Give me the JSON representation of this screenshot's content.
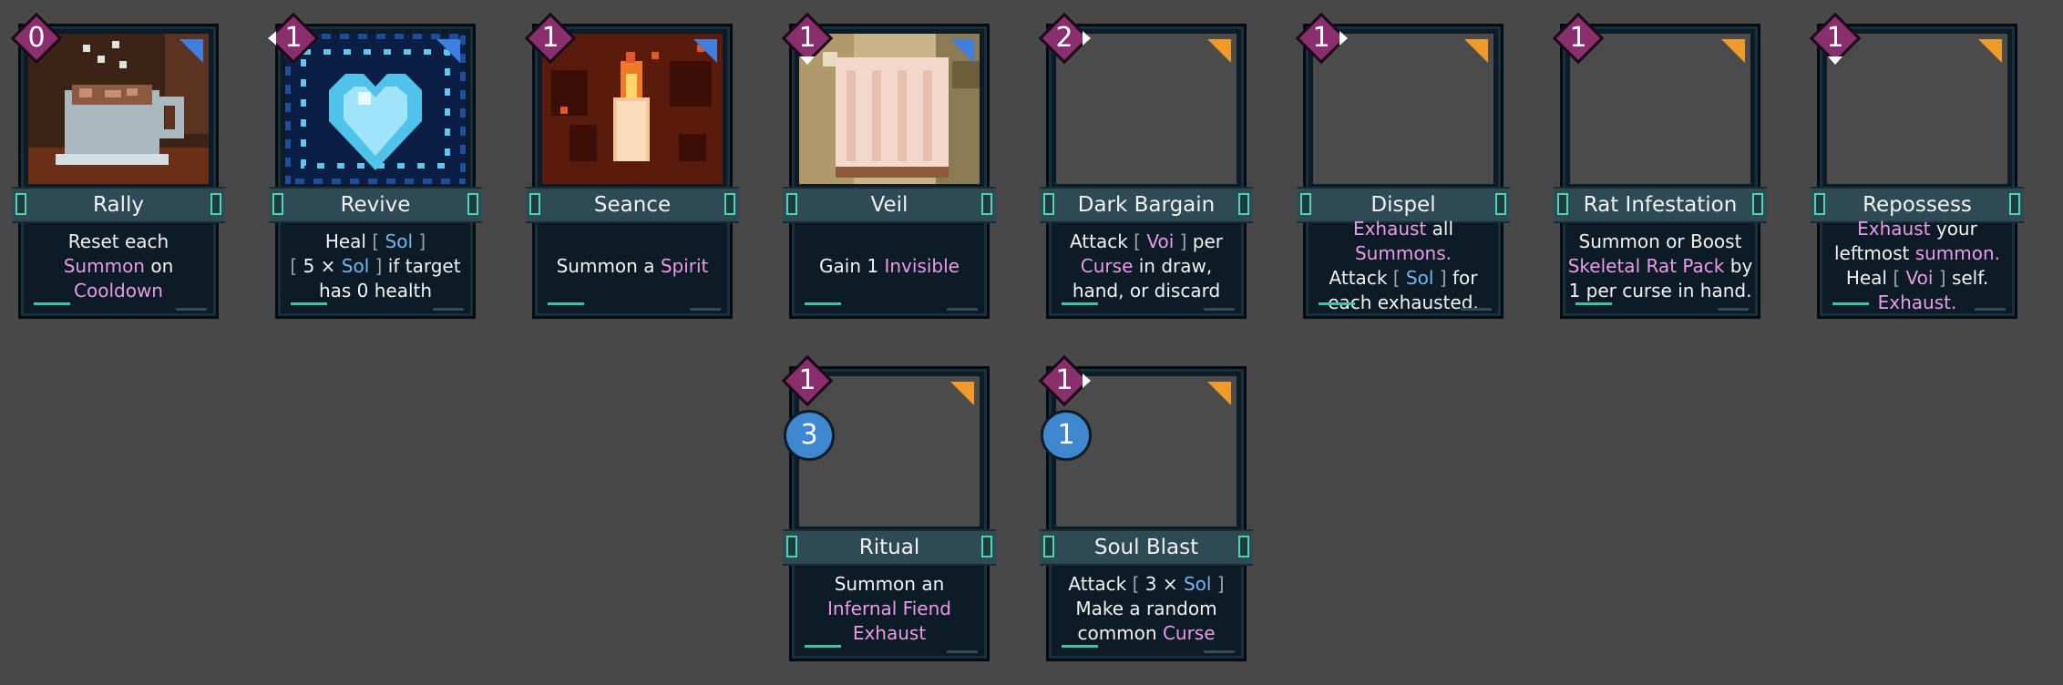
{
  "colors": {
    "background": "#484848",
    "cost_diamond": "#8a2f6d",
    "name_bar": "#2e4a55",
    "keyword_pink": "#e89be8",
    "keyword_blue": "#6fb8f0",
    "charge_circle": "#3f88d0"
  },
  "cards": [
    {
      "name": "Rally",
      "cost": "0",
      "rarity": "rare",
      "art": "coffee-cup",
      "description": [
        [
          {
            "t": "Reset each"
          }
        ],
        [
          {
            "t": "Summon",
            "k": "pink"
          },
          {
            "t": " on"
          }
        ],
        [
          {
            "t": "Cooldown",
            "k": "pink"
          }
        ]
      ]
    },
    {
      "name": "Revive",
      "cost": "1",
      "rarity": "rare",
      "art": "crystal-heart",
      "description": [
        [
          {
            "t": "Heal "
          },
          {
            "t": "[",
            "k": "br"
          },
          {
            "t": " Sol ",
            "k": "blue"
          },
          {
            "t": "]",
            "k": "br"
          }
        ],
        [
          {
            "t": "[",
            "k": "br"
          },
          {
            "t": " 5 × "
          },
          {
            "t": "Sol",
            "k": "blue"
          },
          {
            "t": " ]",
            "k": "br"
          },
          {
            "t": " if target"
          }
        ],
        [
          {
            "t": "has 0 health"
          }
        ]
      ]
    },
    {
      "name": "Seance",
      "cost": "1",
      "rarity": "rare",
      "art": "candle",
      "description": [
        [
          {
            "t": "Summon a "
          },
          {
            "t": "Spirit",
            "k": "pink"
          }
        ]
      ]
    },
    {
      "name": "Veil",
      "cost": "1",
      "rarity": "rare",
      "art": "veil-cloth",
      "description": [
        [
          {
            "t": "Gain 1 "
          },
          {
            "t": "Invisible",
            "k": "pink"
          }
        ]
      ]
    },
    {
      "name": "Dark Bargain",
      "cost": "2",
      "rarity": "common",
      "art": "blank",
      "description": [
        [
          {
            "t": "Attack "
          },
          {
            "t": "[",
            "k": "br"
          },
          {
            "t": " Voi ",
            "k": "pink"
          },
          {
            "t": "]",
            "k": "br"
          },
          {
            "t": " per"
          }
        ],
        [
          {
            "t": "Curse",
            "k": "pink"
          },
          {
            "t": " in draw,"
          }
        ],
        [
          {
            "t": "hand, or discard"
          }
        ]
      ]
    },
    {
      "name": "Dispel",
      "cost": "1",
      "rarity": "common",
      "art": "blank",
      "description": [
        [
          {
            "t": "Exhaust",
            "k": "pink"
          },
          {
            "t": " all"
          }
        ],
        [
          {
            "t": "Summons.",
            "k": "pink"
          }
        ],
        [
          {
            "t": "Attack "
          },
          {
            "t": "[",
            "k": "br"
          },
          {
            "t": " Sol ",
            "k": "blue"
          },
          {
            "t": "]",
            "k": "br"
          },
          {
            "t": " for"
          }
        ],
        [
          {
            "t": "each exhausted."
          }
        ]
      ]
    },
    {
      "name": "Rat Infestation",
      "cost": "1",
      "rarity": "common",
      "art": "blank",
      "description": [
        [
          {
            "t": "Summon or Boost"
          }
        ],
        [
          {
            "t": "Skeletal Rat Pack",
            "k": "pink"
          },
          {
            "t": " by"
          }
        ],
        [
          {
            "t": "1 per curse in hand."
          }
        ]
      ]
    },
    {
      "name": "Repossess",
      "cost": "1",
      "rarity": "common",
      "art": "blank",
      "description": [
        [
          {
            "t": "Exhaust",
            "k": "pink"
          },
          {
            "t": " your"
          }
        ],
        [
          {
            "t": "leftmost "
          },
          {
            "t": "summon.",
            "k": "pink"
          }
        ],
        [
          {
            "t": "Heal "
          },
          {
            "t": "[",
            "k": "br"
          },
          {
            "t": " Voi ",
            "k": "pink"
          },
          {
            "t": "]",
            "k": "br"
          },
          {
            "t": " self."
          }
        ],
        [
          {
            "t": "Exhaust.",
            "k": "pink"
          }
        ]
      ]
    },
    {
      "name": "Ritual",
      "cost": "1",
      "charge": "3",
      "rarity": "common",
      "art": "blank",
      "description": [
        [
          {
            "t": "Summon an"
          }
        ],
        [
          {
            "t": "Infernal Fiend",
            "k": "pink"
          }
        ],
        [
          {
            "t": "Exhaust",
            "k": "pink"
          }
        ]
      ]
    },
    {
      "name": "Soul Blast",
      "cost": "1",
      "charge": "1",
      "rarity": "common",
      "art": "blank",
      "description": [
        [
          {
            "t": "Attack "
          },
          {
            "t": "[",
            "k": "br"
          },
          {
            "t": " 3 × "
          },
          {
            "t": "Sol",
            "k": "blue"
          },
          {
            "t": " ]",
            "k": "br"
          }
        ],
        [
          {
            "t": "Make a random"
          }
        ],
        [
          {
            "t": "common "
          },
          {
            "t": "Curse",
            "k": "pink"
          }
        ]
      ]
    }
  ]
}
